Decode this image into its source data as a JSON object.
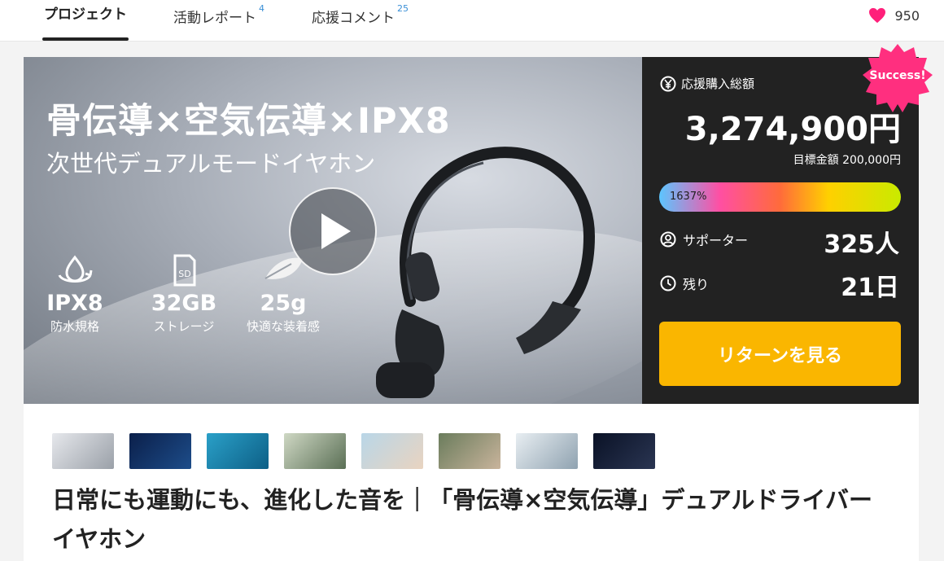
{
  "nav": {
    "tabs": [
      {
        "label": "プロジェクト",
        "count": ""
      },
      {
        "label": "活動レポート",
        "count": "4"
      },
      {
        "label": "応援コメント",
        "count": "25"
      }
    ],
    "favorites": "950"
  },
  "hero": {
    "title": "骨伝導×空気伝導×IPX8",
    "subtitle": "次世代デュアルモードイヤホン",
    "features": [
      {
        "big": "IPX8",
        "small": "防水規格"
      },
      {
        "big": "32GB",
        "small": "ストレージ"
      },
      {
        "big": "25g",
        "small": "快適な装着感"
      }
    ]
  },
  "stats": {
    "amount_label": "応援購入総額",
    "amount": "3,274,900円",
    "goal": "目標金額 200,000円",
    "progress_text": "1637%",
    "progress_percent": 1637,
    "supporters_label": "サポーター",
    "supporters": "325人",
    "remaining_label": "残り",
    "remaining": "21日",
    "cta": "リターンを見る",
    "badge": "Success!"
  },
  "thumbnails": 8,
  "project_title": "日常にも運動にも、進化した音を｜「骨伝導×空気伝導」デュアルドライバーイヤホン",
  "colors": {
    "accent": "#fab600",
    "panel": "#222222",
    "badge": "#ff2f7f",
    "heart": "#ff1f7a"
  }
}
